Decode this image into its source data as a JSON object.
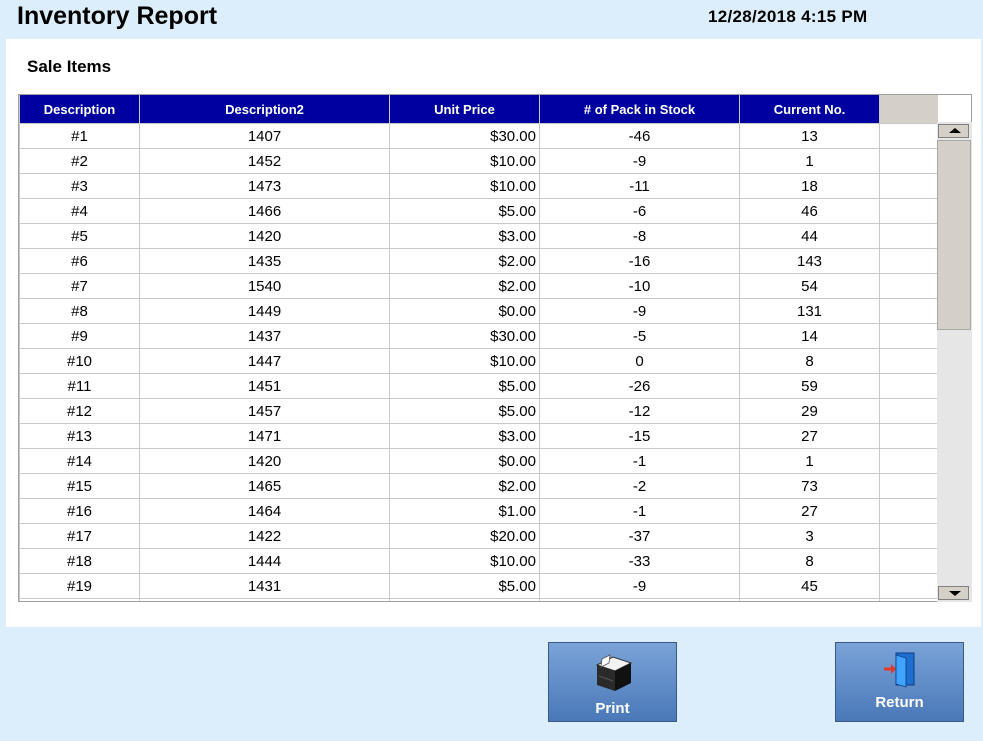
{
  "header": {
    "title": "Inventory Report",
    "datetime": "12/28/2018 4:15 PM"
  },
  "section": {
    "title": "Sale Items"
  },
  "table": {
    "columns": [
      "Description",
      "Description2",
      "Unit Price",
      "# of Pack in Stock",
      "Current No."
    ],
    "rows": [
      [
        "#1",
        "1407",
        "$30.00",
        "-46",
        "13"
      ],
      [
        "#2",
        "1452",
        "$10.00",
        "-9",
        "1"
      ],
      [
        "#3",
        "1473",
        "$10.00",
        "-11",
        "18"
      ],
      [
        "#4",
        "1466",
        "$5.00",
        "-6",
        "46"
      ],
      [
        "#5",
        "1420",
        "$3.00",
        "-8",
        "44"
      ],
      [
        "#6",
        "1435",
        "$2.00",
        "-16",
        "143"
      ],
      [
        "#7",
        "1540",
        "$2.00",
        "-10",
        "54"
      ],
      [
        "#8",
        "1449",
        "$0.00",
        "-9",
        "131"
      ],
      [
        "#9",
        "1437",
        "$30.00",
        "-5",
        "14"
      ],
      [
        "#10",
        "1447",
        "$10.00",
        "0",
        "8"
      ],
      [
        "#11",
        "1451",
        "$5.00",
        "-26",
        "59"
      ],
      [
        "#12",
        "1457",
        "$5.00",
        "-12",
        "29"
      ],
      [
        "#13",
        "1471",
        "$3.00",
        "-15",
        "27"
      ],
      [
        "#14",
        "1420",
        "$0.00",
        "-1",
        "1"
      ],
      [
        "#15",
        "1465",
        "$2.00",
        "-2",
        "73"
      ],
      [
        "#16",
        "1464",
        "$1.00",
        "-1",
        "27"
      ],
      [
        "#17",
        "1422",
        "$20.00",
        "-37",
        "3"
      ],
      [
        "#18",
        "1444",
        "$10.00",
        "-33",
        "8"
      ],
      [
        "#19",
        "1431",
        "$5.00",
        "-9",
        "45"
      ]
    ]
  },
  "buttons": {
    "print": {
      "label": "Print",
      "icon": "printer-icon"
    },
    "return": {
      "label": "Return",
      "icon": "exit-door-icon"
    }
  },
  "colors": {
    "header_bg": "#0000a0",
    "page_bg": "#dceefb",
    "button_bg": "#5a88c8"
  }
}
